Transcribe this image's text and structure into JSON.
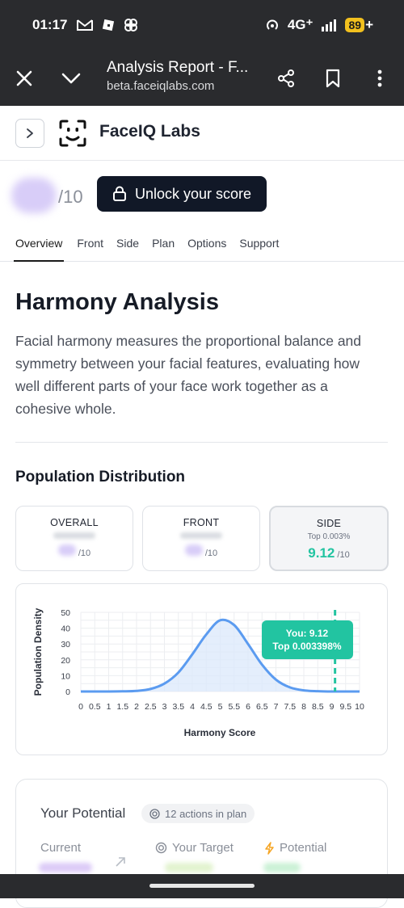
{
  "status_bar": {
    "time": "01:17",
    "network": "4G⁺",
    "battery": "89",
    "battery_suffix": "+"
  },
  "browser": {
    "title": "Analysis Report - F...",
    "url": "beta.faceiqlabs.com"
  },
  "header": {
    "brand": "FaceIQ Labs"
  },
  "score": {
    "out_of": "/10",
    "unlock_label": "Unlock your score"
  },
  "tabs": [
    "Overview",
    "Front",
    "Side",
    "Plan",
    "Options",
    "Support"
  ],
  "section": {
    "heading": "Harmony Analysis",
    "description": "Facial harmony measures the proportional balance and symmetry between your facial features, evaluating how well different parts of your face work together as a cohesive whole."
  },
  "population": {
    "heading": "Population Distribution",
    "cards": [
      {
        "label": "OVERALL",
        "out_of": "/10"
      },
      {
        "label": "FRONT",
        "out_of": "/10"
      },
      {
        "label": "SIDE",
        "sub": "Top 0.003%",
        "value": "9.12",
        "out_of": "/10"
      }
    ]
  },
  "chart_data": {
    "type": "area",
    "xlabel": "Harmony Score",
    "ylabel": "Population Density",
    "xlim": [
      0,
      10
    ],
    "ylim": [
      0,
      50
    ],
    "x_ticks": [
      "0",
      "0.5",
      "1",
      "1.5",
      "2",
      "2.5",
      "3",
      "3.5",
      "4",
      "4.5",
      "5",
      "5.5",
      "6",
      "6.5",
      "7",
      "7.5",
      "8",
      "8.5",
      "9",
      "9.5",
      "10"
    ],
    "y_ticks": [
      "50",
      "40",
      "30",
      "20",
      "10",
      "0"
    ],
    "x": [
      0,
      0.5,
      1,
      1.5,
      2,
      2.5,
      3,
      3.5,
      4,
      4.5,
      5,
      5.5,
      6,
      6.5,
      7,
      7.5,
      8,
      8.5,
      9,
      9.5,
      10
    ],
    "y": [
      0,
      0,
      0,
      0.1,
      0.4,
      1.6,
      5,
      12,
      23.5,
      36,
      45,
      42,
      30,
      17,
      7.5,
      2.6,
      0.7,
      0.2,
      0,
      0,
      0
    ],
    "marker_x": 9.12,
    "tooltip_line1": "You: 9.12",
    "tooltip_line2": "Top 0.003398%",
    "grid": true,
    "colors": {
      "line": "#5b9bf0",
      "fill": "#dbe8fb",
      "marker": "#22c4a1"
    }
  },
  "potential": {
    "title": "Your Potential",
    "pill": "12 actions in plan",
    "current": "Current",
    "target": "Your Target",
    "potential": "Potential"
  }
}
